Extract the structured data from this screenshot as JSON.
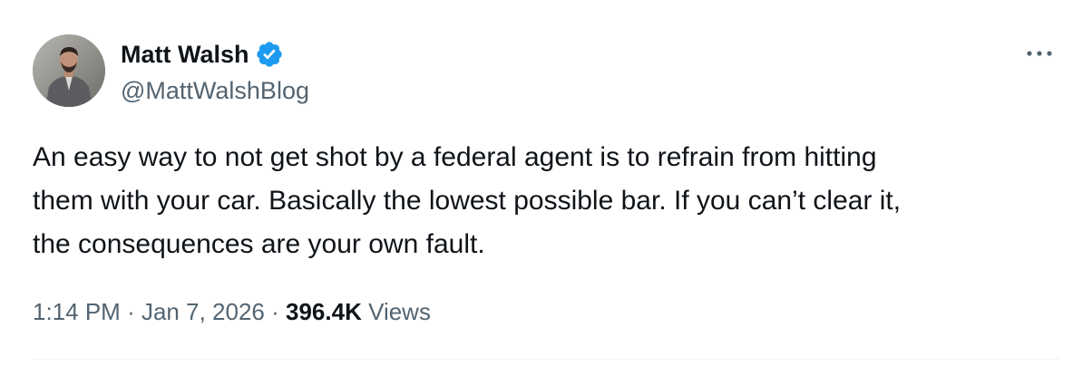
{
  "author": {
    "display_name": "Matt Walsh",
    "handle": "@MattWalshBlog",
    "verified": true,
    "verified_color": "#1d9bf0",
    "avatar_icon": "user-avatar-photo"
  },
  "menu": {
    "more_icon": "more-horizontal-icon"
  },
  "tweet": {
    "text_lines": [
      "An easy way to not get shot by a federal agent is to refrain from hitting",
      "them with your car. Basically the lowest possible bar. If you can’t clear it,",
      "the consequences are your own fault."
    ]
  },
  "meta": {
    "time": "1:14 PM",
    "separator": "·",
    "date": "Jan 7, 2026",
    "views_count": "396.4K",
    "views_label": "Views"
  },
  "colors": {
    "text_primary": "#0f1419",
    "text_secondary": "#536471",
    "divider": "#eff3f4"
  }
}
